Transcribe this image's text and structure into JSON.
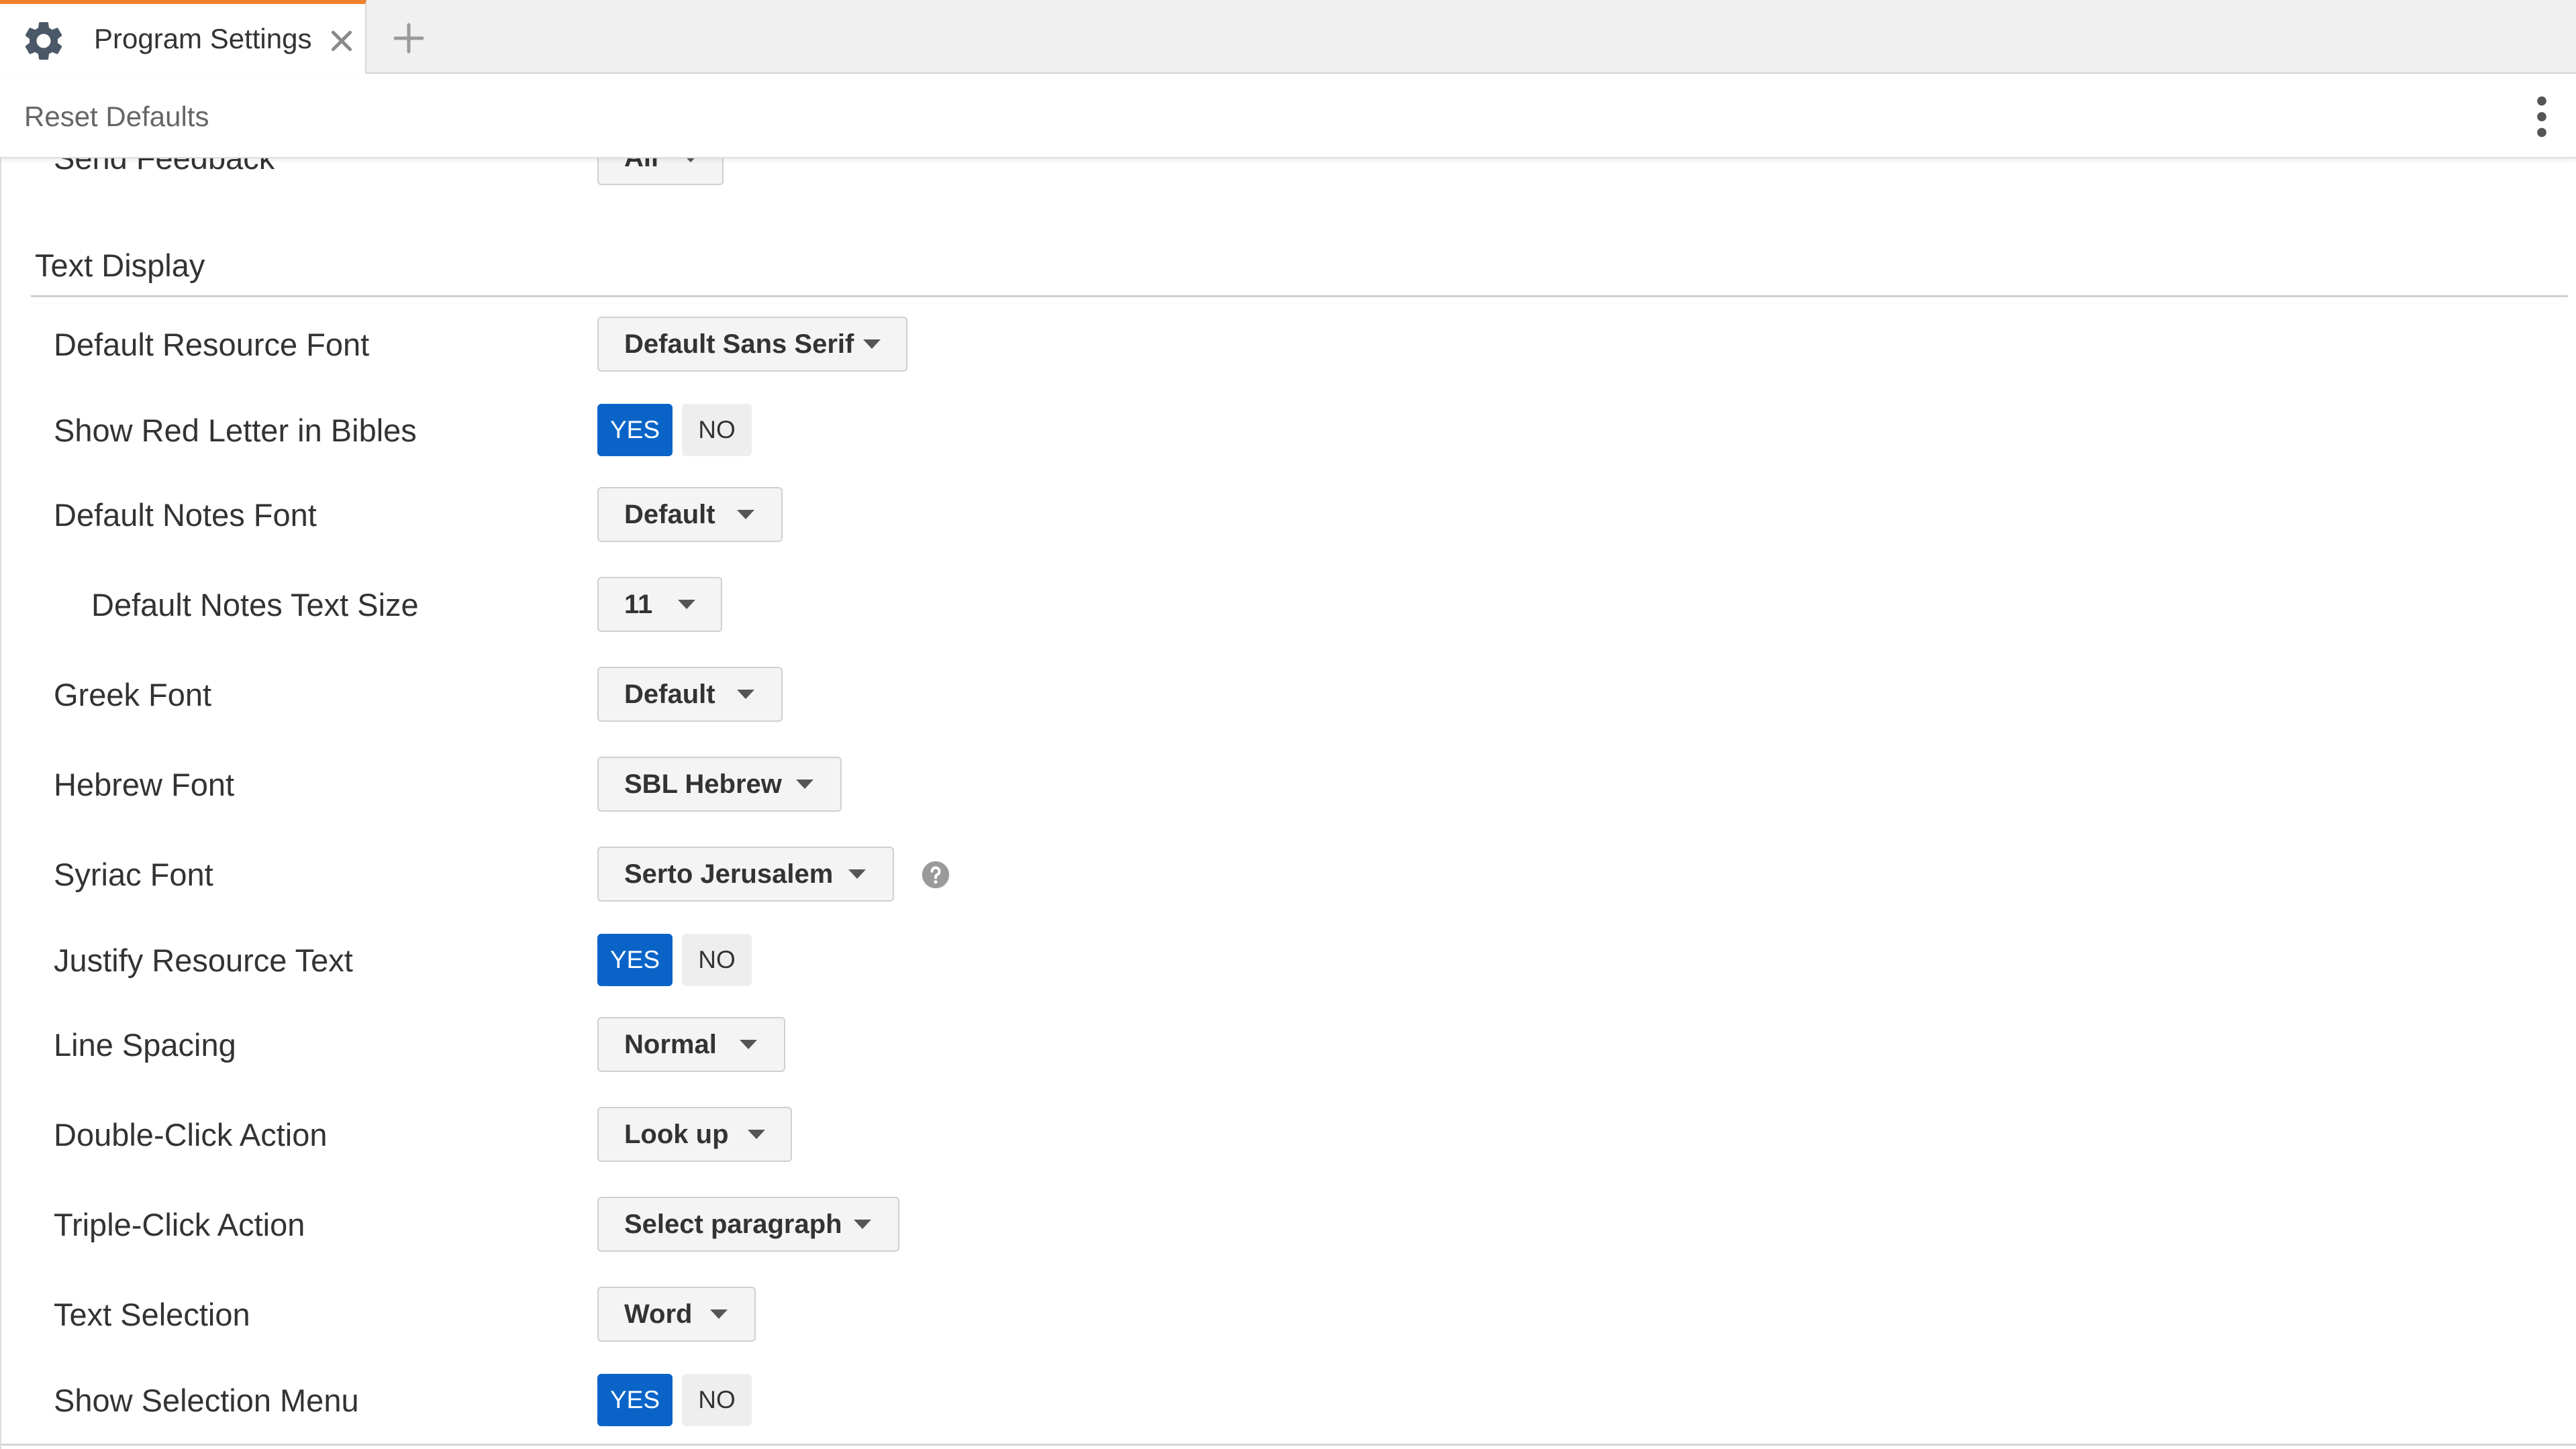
{
  "tab": {
    "title": "Program Settings"
  },
  "toolbar": {
    "reset_label": "Reset Defaults"
  },
  "colors": {
    "accent": "#f0812c",
    "toggle_selected": "#0a64c8"
  },
  "partial_row": {
    "label": "Send Feedback",
    "value": "All"
  },
  "section": {
    "title": "Text Display",
    "rows": {
      "resource_font": {
        "label": "Default Resource Font",
        "value": "Default Sans Serif"
      },
      "red_letter": {
        "label": "Show Red Letter in Bibles",
        "yes": "YES",
        "no": "NO",
        "selected": "YES"
      },
      "notes_font": {
        "label": "Default Notes Font",
        "value": "Default"
      },
      "notes_size": {
        "label": "Default Notes Text Size",
        "value": "11"
      },
      "greek_font": {
        "label": "Greek Font",
        "value": "Default"
      },
      "hebrew_font": {
        "label": "Hebrew Font",
        "value": "SBL Hebrew"
      },
      "syriac_font": {
        "label": "Syriac Font",
        "value": "Serto Jerusalem"
      },
      "justify": {
        "label": "Justify Resource Text",
        "yes": "YES",
        "no": "NO",
        "selected": "YES"
      },
      "line_spacing": {
        "label": "Line Spacing",
        "value": "Normal"
      },
      "double_click": {
        "label": "Double-Click Action",
        "value": "Look up"
      },
      "triple_click": {
        "label": "Triple-Click Action",
        "value": "Select paragraph"
      },
      "text_selection": {
        "label": "Text Selection",
        "value": "Word"
      },
      "selection_menu": {
        "label": "Show Selection Menu",
        "yes": "YES",
        "no": "NO",
        "selected": "YES"
      }
    }
  },
  "icons": [
    "gear-icon",
    "close-icon",
    "plus-icon",
    "more-vertical-icon",
    "help-icon",
    "caret-down-icon"
  ]
}
